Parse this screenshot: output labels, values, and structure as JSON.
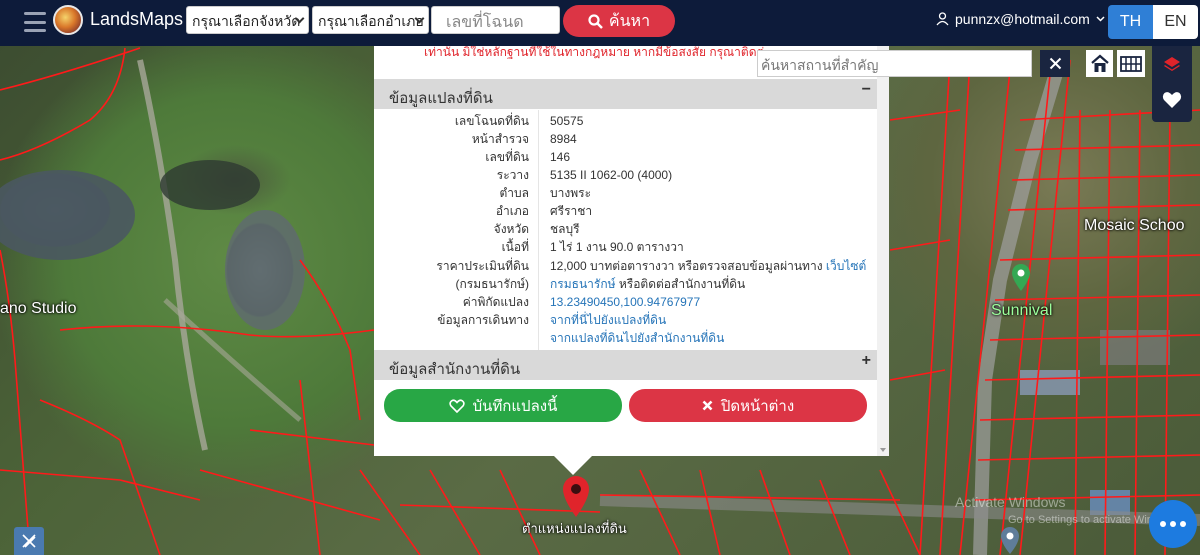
{
  "header": {
    "brand": "LandsMaps",
    "province_select": "กรุณาเลือกจังหวัด",
    "district_select": "กรุณาเลือกอำเภอ",
    "deed_placeholder": "เลขที่โฉนด",
    "search_button": "ค้นหา",
    "user_email": "punnzx@hotmail.com",
    "lang_th": "TH",
    "lang_en": "EN"
  },
  "notice": "เท่านั้น มิใช่หลักฐานที่ใช้ในทางกฎหมาย หากมีข้อสงสัย กรุณาติดต่อสำนักงานที่ดิน",
  "place_search_placeholder": "ค้นหาสถานที่สำคัญ",
  "parcel_panel": {
    "title": "ข้อมูลแปลงที่ดิน",
    "collapse": "−",
    "rows": [
      {
        "label": "เลขโฉนดที่ดิน",
        "value": "50575"
      },
      {
        "label": "หน้าสำรวจ",
        "value": "8984"
      },
      {
        "label": "เลขที่ดิน",
        "value": "146"
      },
      {
        "label": "ระวาง",
        "value": "5135 II 1062-00 (4000)"
      },
      {
        "label": "ตำบล",
        "value": "บางพระ"
      },
      {
        "label": "อำเภอ",
        "value": "ศรีราชา"
      },
      {
        "label": "จังหวัด",
        "value": "ชลบุรี"
      },
      {
        "label": "เนื้อที่",
        "value": "1 ไร่ 1 งาน 90.0 ตารางวา"
      }
    ],
    "appraisal_label": "ราคาประเมินที่ดิน",
    "appraisal_text": "12,000 บาทต่อตารางวา หรือตรวจสอบข้อมูลผ่านทาง",
    "appraisal_link": "เว็บไซต์",
    "appraisal_label2": "(กรมธนารักษ์)",
    "appraisal_link2": "กรมธนารักษ์",
    "appraisal_text2": "หรือติดต่อสำนักงานที่ดิน",
    "coord_label": "ค่าพิกัดแปลง",
    "coord_value": "13.23490450,100.94767977",
    "travel_label": "ข้อมูลการเดินทาง",
    "travel_link1": "จากที่นี่ไปยังแปลงที่ดิน",
    "travel_link2": "จากแปลงที่ดินไปยังสำนักงานที่ดิน"
  },
  "office_panel": {
    "title": "ข้อมูลสำนักงานที่ดิน",
    "expand": "+"
  },
  "actions": {
    "save": "บันทึกแปลงนี้",
    "close": "ปิดหน้าต่าง"
  },
  "map_labels": {
    "left": "ano Studio",
    "right": "Mosaic Schoo",
    "sunnival": "Sunnival",
    "pin": "ตำแหน่งแปลงที่ดิน"
  },
  "watermark": {
    "line1": "Activate Windows",
    "line2": "Go to Settings to activate Windows."
  },
  "colors": {
    "navbar": "#0d1b3a",
    "save": "#28a745",
    "close": "#dc3545",
    "parcel_lines": "#ff1a1a",
    "lang_active": "#2f7fd6"
  }
}
